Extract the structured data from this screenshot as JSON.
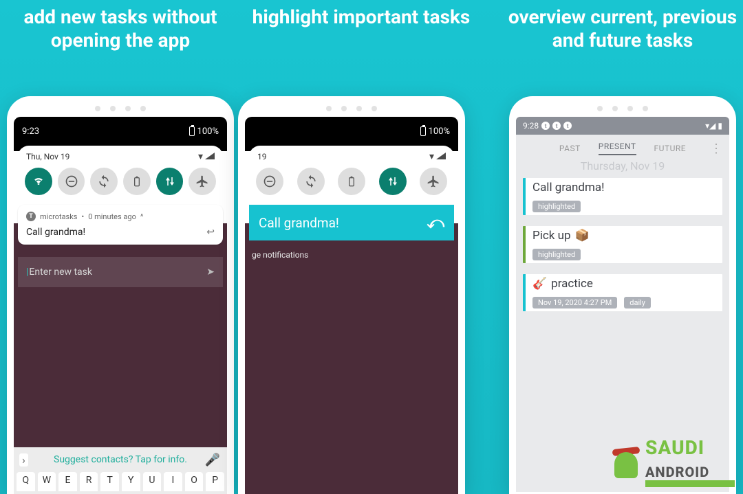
{
  "headlines": {
    "p1": "add new tasks without opening the app",
    "p2": "highlight important tasks",
    "p3": "overview current, previous and future tasks"
  },
  "status": {
    "time1": "9:23",
    "time3": "9:28",
    "battery": "100%"
  },
  "qs": {
    "date": "Thu, Nov 19",
    "date_frag": "19"
  },
  "notif": {
    "app": "microtasks",
    "meta": "0 minutes ago",
    "caret": "^",
    "body": "Call grandma!"
  },
  "input": {
    "placeholder": "Enter new task"
  },
  "suggest": "Suggest contacts? Tap for info.",
  "keys": [
    "Q",
    "W",
    "E",
    "R",
    "T",
    "Y",
    "U",
    "I",
    "O",
    "P"
  ],
  "highlight": {
    "title": "Call grandma!",
    "sub": "ge notifications"
  },
  "tabs": {
    "past": "PAST",
    "present": "PRESENT",
    "future": "FUTURE"
  },
  "p3_date": "Thursday, Nov 19",
  "tasks": {
    "t1": {
      "title": "Call grandma!",
      "badge": "highlighted"
    },
    "t2": {
      "title": "Pick up",
      "emoji": "📦",
      "badge": "highlighted"
    },
    "t3": {
      "title": "practice",
      "emoji": "🎸",
      "badge1": "Nov 19, 2020 4:27 PM",
      "badge2": "daily"
    }
  },
  "logo": {
    "line1": "SAUDI",
    "line2": "ANDROID"
  }
}
